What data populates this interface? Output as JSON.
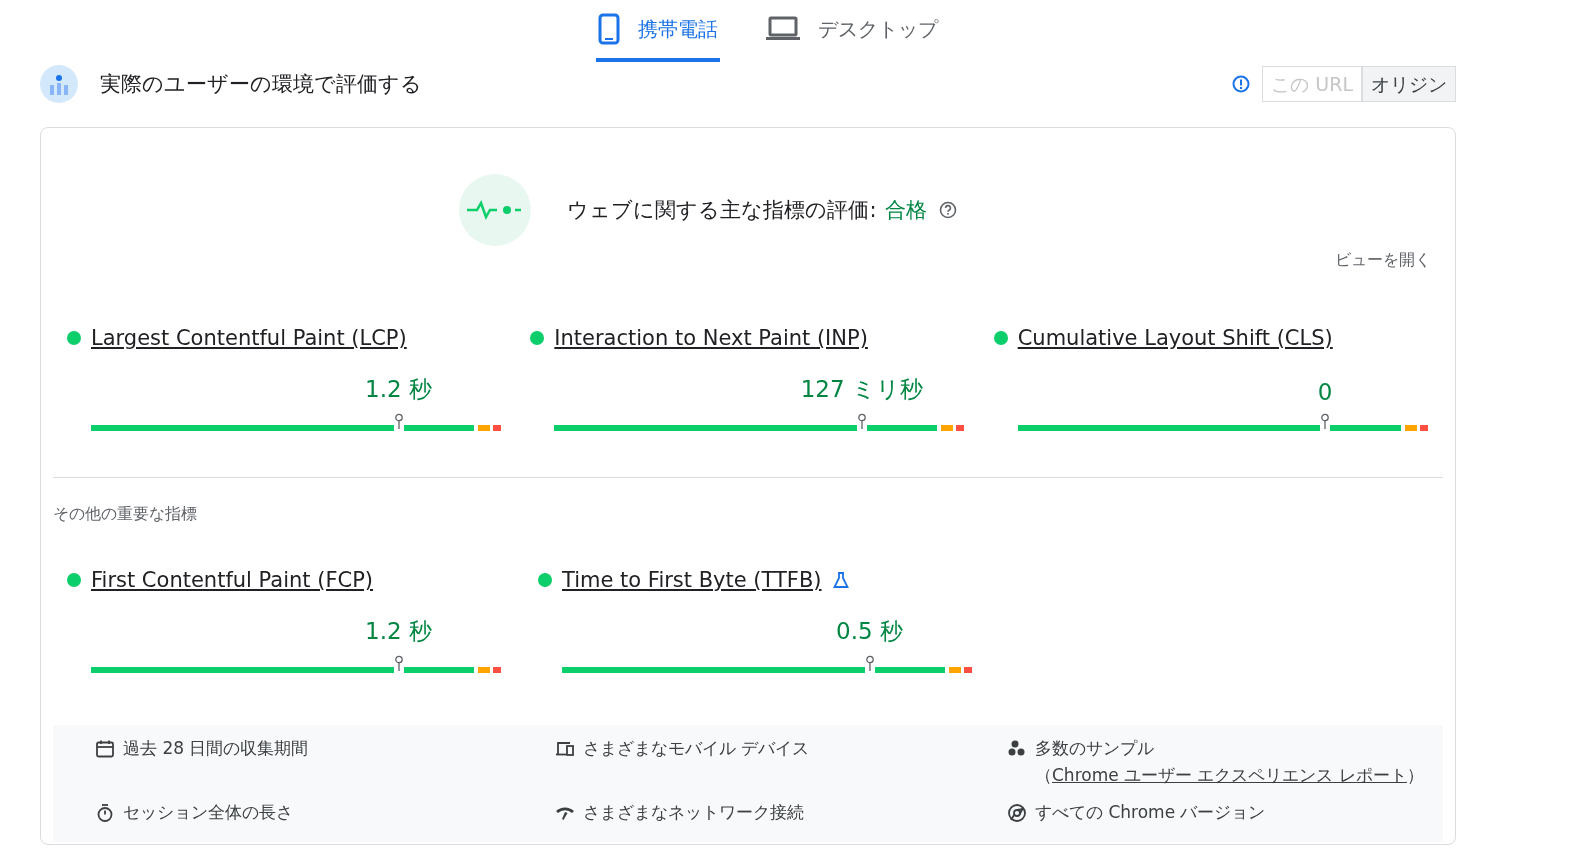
{
  "tabs": [
    {
      "label": "携帯電話",
      "selected": true
    },
    {
      "label": "デスクトップ",
      "selected": false
    }
  ],
  "header": {
    "title": "実際のユーザーの環境で評価する",
    "toggle": [
      {
        "label": "この URL",
        "selected": false,
        "disabled": true
      },
      {
        "label": "オリジン",
        "selected": true,
        "disabled": false
      }
    ]
  },
  "assessment": {
    "label": "ウェブに関する主な指標の評価:",
    "result": "合格",
    "expand_link": "ビューを開く"
  },
  "core_metrics": [
    {
      "name": "Largest Contentful Paint (LCP)",
      "value": "1.2 秒",
      "color": "#0cce6b",
      "level": 0.75,
      "experimental": false
    },
    {
      "name": "Interaction to Next Paint (INP)",
      "value": "127 ミリ秒",
      "color": "#0cce6b",
      "level": 0.75,
      "experimental": false
    },
    {
      "name": "Cumulative Layout Shift (CLS)",
      "value": "0",
      "color": "#0cce6b",
      "level": 0.75,
      "experimental": false
    }
  ],
  "other_heading": "その他の重要な指標",
  "other_metrics": [
    {
      "name": "First Contentful Paint (FCP)",
      "value": "1.2 秒",
      "color": "#0cce6b",
      "level": 0.75,
      "experimental": false
    },
    {
      "name": "Time to First Byte (TTFB)",
      "value": "0.5 秒",
      "color": "#0cce6b",
      "level": 0.75,
      "experimental": true
    }
  ],
  "footer": [
    {
      "text": "過去 28 日間の収集期間"
    },
    {
      "text": "さまざまなモバイル デバイス"
    },
    {
      "text": "多数のサンプル（",
      "link": "Chrome ユーザー エクスペリエンス レポート",
      "text_after": "）"
    },
    {
      "text": "セッション全体の長さ"
    },
    {
      "text": "さまざまなネットワーク接続"
    },
    {
      "text": "すべての Chrome バージョン"
    }
  ]
}
